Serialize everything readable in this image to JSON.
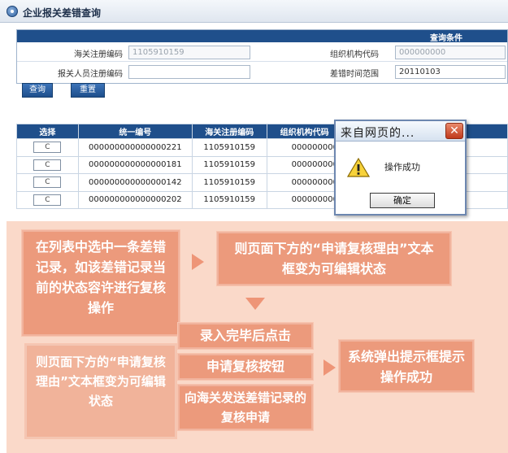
{
  "header": {
    "title": "企业报关差错查询"
  },
  "form": {
    "band_title": "查询条件",
    "customs_reg_label": "海关注册编码",
    "customs_reg_value": "1105910159",
    "org_code_label": "组织机构代码",
    "org_code_value": "000000000",
    "staff_reg_label": "报关人员注册编码",
    "staff_reg_value": "",
    "date_range_label": "差错时间范围",
    "date_range_value": "20110103"
  },
  "buttons": {
    "query": "查询",
    "reset": "重置"
  },
  "table": {
    "headers": [
      "选择",
      "统一编号",
      "海关注册编码",
      "组织机构代码"
    ],
    "rows": [
      {
        "radio": "C",
        "uid": "000000000000000221",
        "customs": "1105910159",
        "org": "000000000"
      },
      {
        "radio": "C",
        "uid": "000000000000000181",
        "customs": "1105910159",
        "org": "000000000"
      },
      {
        "radio": "C",
        "uid": "000000000000000142",
        "customs": "1105910159",
        "org": "000000000"
      },
      {
        "radio": "C",
        "uid": "000000000000000202",
        "customs": "1105910159",
        "org": "000000000"
      }
    ]
  },
  "dialog": {
    "title": "来自网页的...",
    "message": "操作成功",
    "ok_label": "确定",
    "close_glyph": "✕"
  },
  "annotations": {
    "step1": "在列表中选中一条差错记录，如该差错记录当前的状态容许进行复核操作",
    "step1b": "则页面下方的“申请复核理由”文本框变为可编辑状态",
    "step2": "则页面下方的“申请复核理由”文本框变为可编辑状态",
    "step3a": "录入完毕后点击",
    "step3b": "申请复核按钮",
    "step3c": "向海关发送差错记录的复核申请",
    "step4": "系统弹出提示框提示操作成功"
  },
  "colors": {
    "nav_blue": "#1f4f8b",
    "annotation_fill": "#ec9a7c",
    "panel_bg": "#fad9c9"
  }
}
